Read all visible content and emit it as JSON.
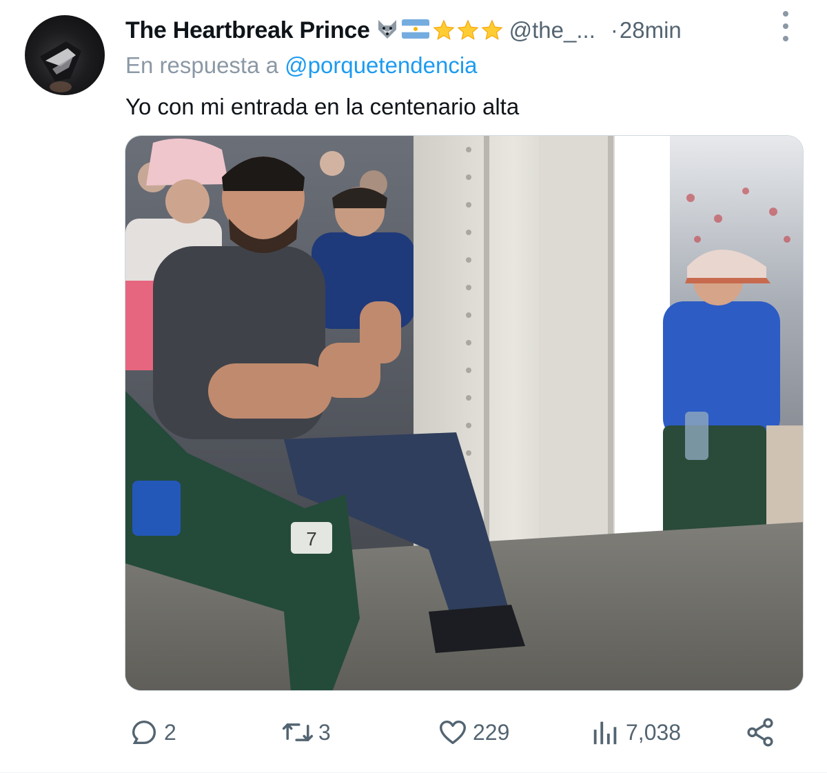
{
  "author": {
    "display_name": "The Heartbreak Prince",
    "handle": "@the_...",
    "separator": "·",
    "timestamp": "28min",
    "badges": [
      "wolf-emoji",
      "argentina-flag-emoji",
      "star-emoji",
      "star-emoji",
      "star-emoji"
    ]
  },
  "reply": {
    "prefix": "En respuesta a",
    "mention": "@porquetendencia"
  },
  "tweet": {
    "text": "Yo con mi entrada en la centenario alta"
  },
  "media": {
    "seat_number": "7"
  },
  "actions": {
    "replies": "2",
    "retweets": "3",
    "likes": "229",
    "views": "7,038"
  },
  "colors": {
    "text_primary": "#0f1419",
    "text_secondary": "#536471",
    "link": "#1d9bf0",
    "star": "#ffcc33"
  }
}
